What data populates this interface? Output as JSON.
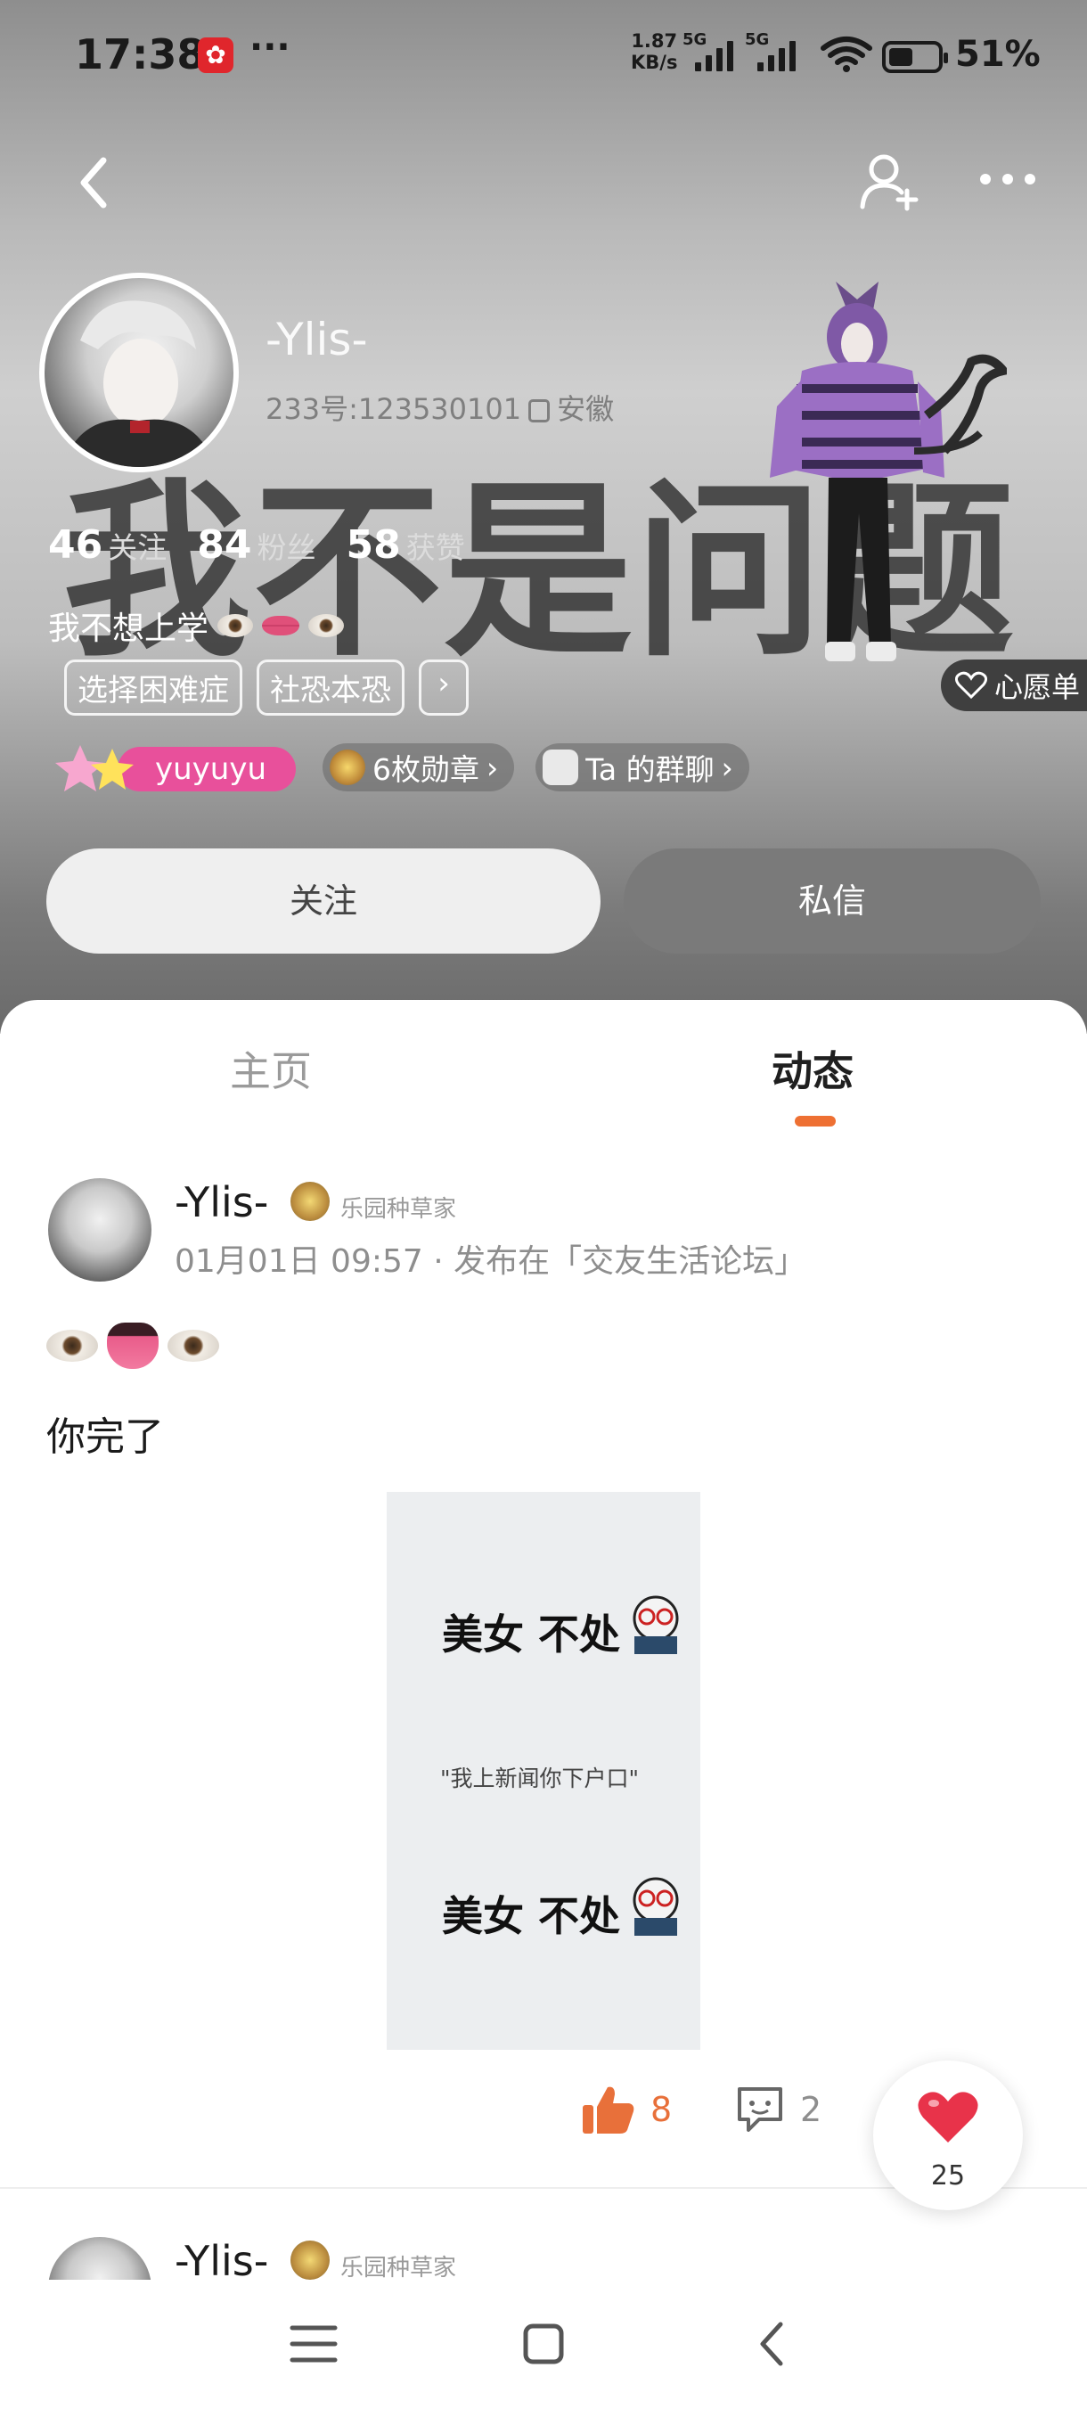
{
  "status_bar": {
    "time": "17:38",
    "notification_icon": "app-notification-icon",
    "more_dots": "···",
    "net_speed_value": "1.87",
    "net_speed_unit": "KB/s",
    "sim1": "5G",
    "sim2": "5G",
    "battery_pct": "51%"
  },
  "profile": {
    "background_caption": "我不是问题",
    "username": "-Ylis-",
    "uid_label": "233号:123530101",
    "location": "安徽",
    "stats": [
      {
        "num": "46",
        "label": "关注"
      },
      {
        "num": "84",
        "label": "粉丝"
      },
      {
        "num": "58",
        "label": "获赞"
      }
    ],
    "bio": "我不想上学",
    "tags": [
      "选择困难症",
      "社恐本恐",
      "›"
    ],
    "wishlist": "心愿单",
    "badge_name": "yuyuyu",
    "medals": "6枚勋章",
    "group_chat": "Ta 的群聊",
    "follow_btn": "关注",
    "message_btn": "私信"
  },
  "tabs": {
    "home": "主页",
    "feed": "动态"
  },
  "post": {
    "author": "-Ylis-",
    "badge": "乐园种草家",
    "meta": "01月01日 09:57 · 发布在「交友生活论坛」",
    "text": "你完了",
    "image": {
      "line1": "美女  不处",
      "line2": "\"我上新闻你下户口\"",
      "line3": "美女  不处"
    },
    "likes": "8",
    "comments": "2",
    "favorite_count": "25"
  },
  "post2": {
    "author": "-Ylis-",
    "badge": "乐园种草家"
  },
  "colors": {
    "accent": "#ee7033",
    "pink": "#e8509b",
    "heart": "#e8334a"
  }
}
